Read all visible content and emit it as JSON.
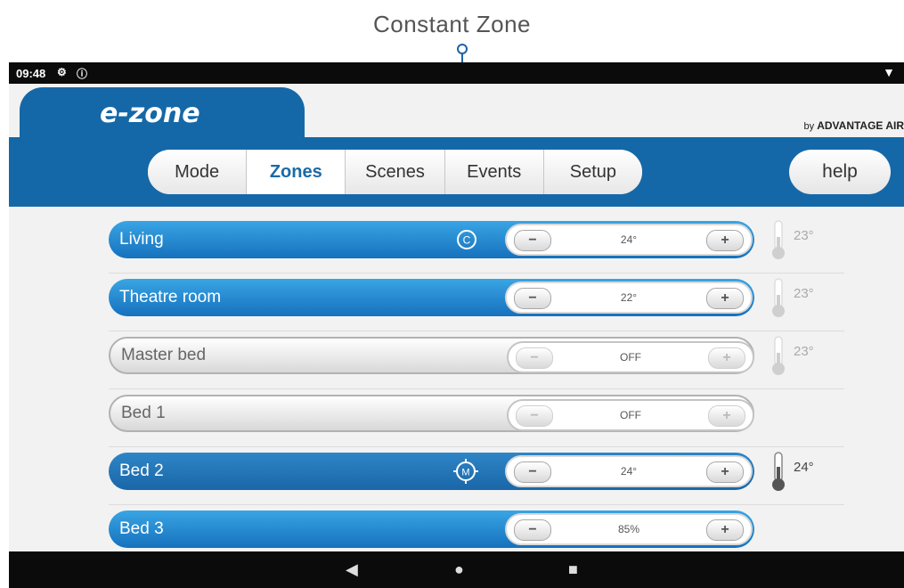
{
  "annotation": {
    "label": "Constant Zone"
  },
  "status_bar": {
    "time": "09:48"
  },
  "header": {
    "brand": "e-zone",
    "byline_prefix": "by",
    "byline_brand": "ADVANTAGE AIR"
  },
  "nav": {
    "tabs": [
      {
        "label": "Mode",
        "active": false
      },
      {
        "label": "Zones",
        "active": true
      },
      {
        "label": "Scenes",
        "active": false
      },
      {
        "label": "Events",
        "active": false
      },
      {
        "label": "Setup",
        "active": false
      }
    ],
    "help_label": "help"
  },
  "zones": [
    {
      "name": "Living",
      "state": "on",
      "value": "24°",
      "mode_icon": "constant-icon",
      "mode_letter": "C",
      "room_temp": "23°",
      "thermometer": "light"
    },
    {
      "name": "Theatre room",
      "state": "on",
      "value": "22°",
      "mode_icon": "",
      "mode_letter": "",
      "room_temp": "23°",
      "thermometer": "light"
    },
    {
      "name": "Master bed",
      "state": "off",
      "value": "OFF",
      "mode_icon": "",
      "mode_letter": "",
      "room_temp": "23°",
      "thermometer": "light"
    },
    {
      "name": "Bed 1",
      "state": "off",
      "value": "OFF",
      "mode_icon": "",
      "mode_letter": "",
      "room_temp": "",
      "thermometer": ""
    },
    {
      "name": "Bed 2",
      "state": "sel",
      "value": "24°",
      "mode_icon": "myzone-target-icon",
      "mode_letter": "M",
      "room_temp": "24°",
      "thermometer": "dark"
    },
    {
      "name": "Bed 3",
      "state": "on",
      "value": "85%",
      "mode_icon": "",
      "mode_letter": "",
      "room_temp": "",
      "thermometer": ""
    }
  ],
  "stepper": {
    "minus": "−",
    "plus": "+"
  },
  "colors": {
    "brand_blue": "#1568a7",
    "zone_on": "#2b8fd4",
    "active_tab_text": "#1a6aa8"
  }
}
